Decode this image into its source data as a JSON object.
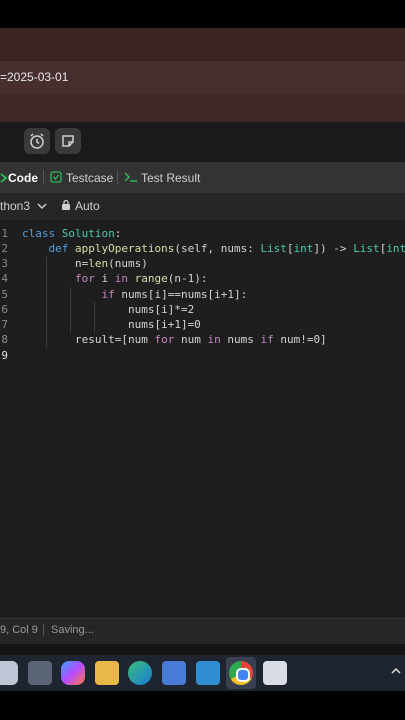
{
  "header": {
    "date_text": "=2025-03-01"
  },
  "tabs": {
    "code_label": "Code",
    "testcase_label": "Testcase",
    "test_result_label": "Test Result"
  },
  "lang_bar": {
    "language": "thon3",
    "mode": "Auto"
  },
  "editor": {
    "line_numbers": [
      "1",
      "2",
      "3",
      "4",
      "5",
      "6",
      "7",
      "8",
      "9"
    ]
  },
  "status": {
    "position": "9, Col 9",
    "state": "Saving..."
  },
  "icons": [
    "alarm-icon",
    "note-icon",
    "code-icon",
    "check-box-icon",
    "terminal-icon",
    "chevron-down-icon",
    "lock-icon"
  ],
  "colors": {
    "accent_green": "#2cbb5d",
    "editor_bg": "#1e1e1e"
  }
}
